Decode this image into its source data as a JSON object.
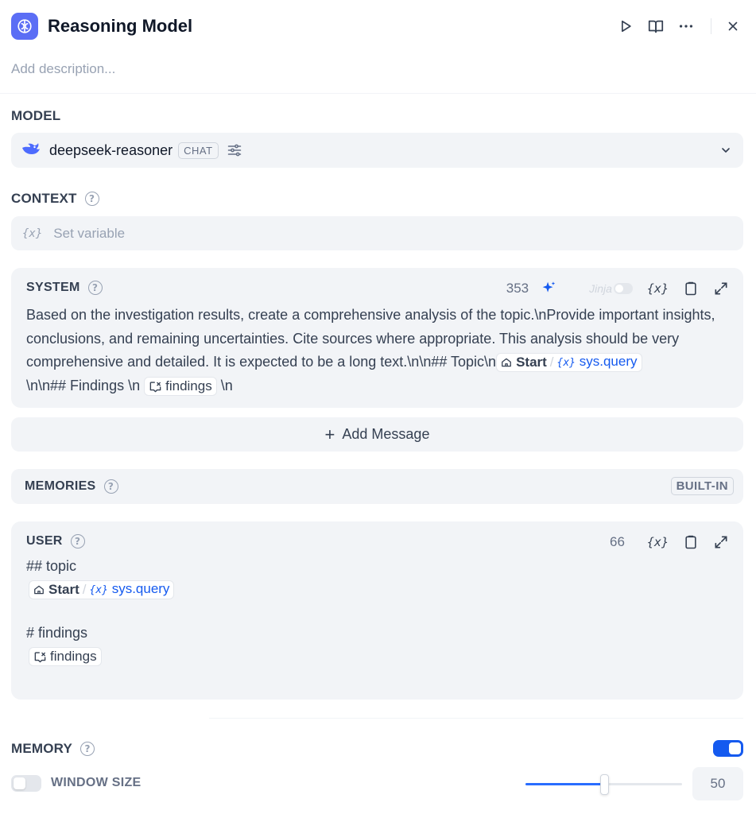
{
  "header": {
    "title": "Reasoning Model",
    "icon": "brain-icon",
    "actions": [
      "run-icon",
      "book-icon",
      "more-icon",
      "close-icon"
    ]
  },
  "description": {
    "placeholder": "Add description..."
  },
  "model": {
    "label": "MODEL",
    "name": "deepseek-reasoner",
    "mode": "CHAT",
    "icon": "whale-icon"
  },
  "context": {
    "label": "CONTEXT",
    "placeholder": "Set variable"
  },
  "system": {
    "label": "SYSTEM",
    "count": "353",
    "jinja_label": "Jinja",
    "text_1": "  Based on the investigation results, create a comprehensive analysis of the topic.\\nProvide important insights, conclusions, and remaining uncertainties. Cite sources where appropriate. This analysis should be very comprehensive and detailed. It is expected to be a long text.\\n\\n## Topic\\n",
    "chip_node": "Start",
    "chip_var": "sys.query",
    "text_2": "\\n\\n## Findings \\n",
    "chip_findings": "findings",
    "text_3": "\\n"
  },
  "add_message": {
    "label": "Add Message"
  },
  "memories": {
    "label": "MEMORIES",
    "badge": "BUILT-IN"
  },
  "user": {
    "label": "USER",
    "count": "66",
    "line_1": "## topic",
    "chip_node": "Start",
    "chip_var": "sys.query",
    "line_2": "# findings",
    "chip_findings": "findings"
  },
  "memory": {
    "label": "MEMORY",
    "enabled": true,
    "window_size_label": "WINDOW SIZE",
    "window_size_enabled": false,
    "window_size_value": "50",
    "slider_fraction": 0.5
  },
  "colors": {
    "accent": "#155aef",
    "app_icon": "#5b6ef5",
    "panel_bg": "#f2f4f7"
  }
}
